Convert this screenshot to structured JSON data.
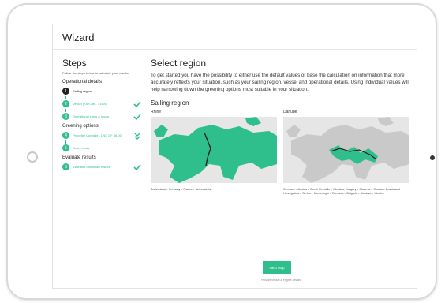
{
  "app": {
    "title": "Wizard"
  },
  "sidebar": {
    "title": "Steps",
    "hint": "Follow the steps below to calculate your results.",
    "groups": [
      {
        "title": "Operational details",
        "steps": [
          {
            "num": "1",
            "label": "Sailing region",
            "active": true,
            "done": false
          },
          {
            "num": "2",
            "label": "Vessel (Kort 2m - >1500",
            "active": false,
            "done": true
          },
          {
            "num": "3",
            "label": "Operational costs & hours",
            "active": false,
            "done": true
          }
        ]
      },
      {
        "title": "Greening options",
        "steps": [
          {
            "num": "4",
            "label": "Propeller Upgrade - LNG DF 86.00",
            "active": false,
            "done": true
          },
          {
            "num": "5",
            "label": "Active costs",
            "active": false,
            "done": true
          }
        ]
      },
      {
        "title": "Evaluate results",
        "steps": [
          {
            "num": "6",
            "label": "View and download results",
            "active": false,
            "done": true
          }
        ]
      }
    ]
  },
  "main": {
    "title": "Select region",
    "description": "To get started you have the possibility to either use the default values or base the calculation on information that more accurately reflects your situation, such as your sailing region, vessel and operational details. Using individual values will help narrowing down the greening options most suitable in your situation.",
    "section_title": "Sailing region",
    "regions": [
      {
        "name": "Rhine",
        "countries": "Switzerland > Germany > France > Netherlands",
        "selected": true
      },
      {
        "name": "Danube",
        "countries": "Germany > Austria > Czech Republic > Slovakia, Hungary > Slovenia > Croatia > Bosnia and Herzegovina > Serbia > Montenegro > Romania > Bulgaria > Moldova > Ukraine",
        "selected": false
      }
    ],
    "next_label": "Next step",
    "next_hint": "Provide vessel & engine details"
  },
  "colors": {
    "accent": "#2fbf8c",
    "map_bg": "#e6e6e6",
    "land_inactive": "#c9c9c9"
  }
}
